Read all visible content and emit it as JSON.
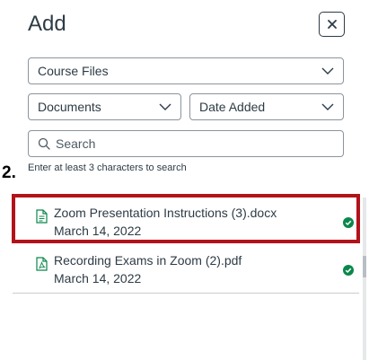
{
  "dialog": {
    "title": "Add",
    "close_label": "×"
  },
  "filters": {
    "source": "Course Files",
    "type": "Documents",
    "sort": "Date Added"
  },
  "search": {
    "placeholder": "Search",
    "hint": "Enter at least 3 characters to search"
  },
  "annotation": {
    "step": "2."
  },
  "files": [
    {
      "name": "Zoom Presentation Instructions (3).docx",
      "date": "March 14, 2022",
      "icon": "document-icon",
      "status": "check-circle-icon"
    },
    {
      "name": "Recording Exams in Zoom (2).pdf",
      "date": "March 14, 2022",
      "icon": "pdf-icon",
      "status": "check-circle-icon"
    }
  ],
  "colors": {
    "highlight": "#b3121a",
    "success": "#0b874b",
    "file_icon": "#0b874b"
  }
}
